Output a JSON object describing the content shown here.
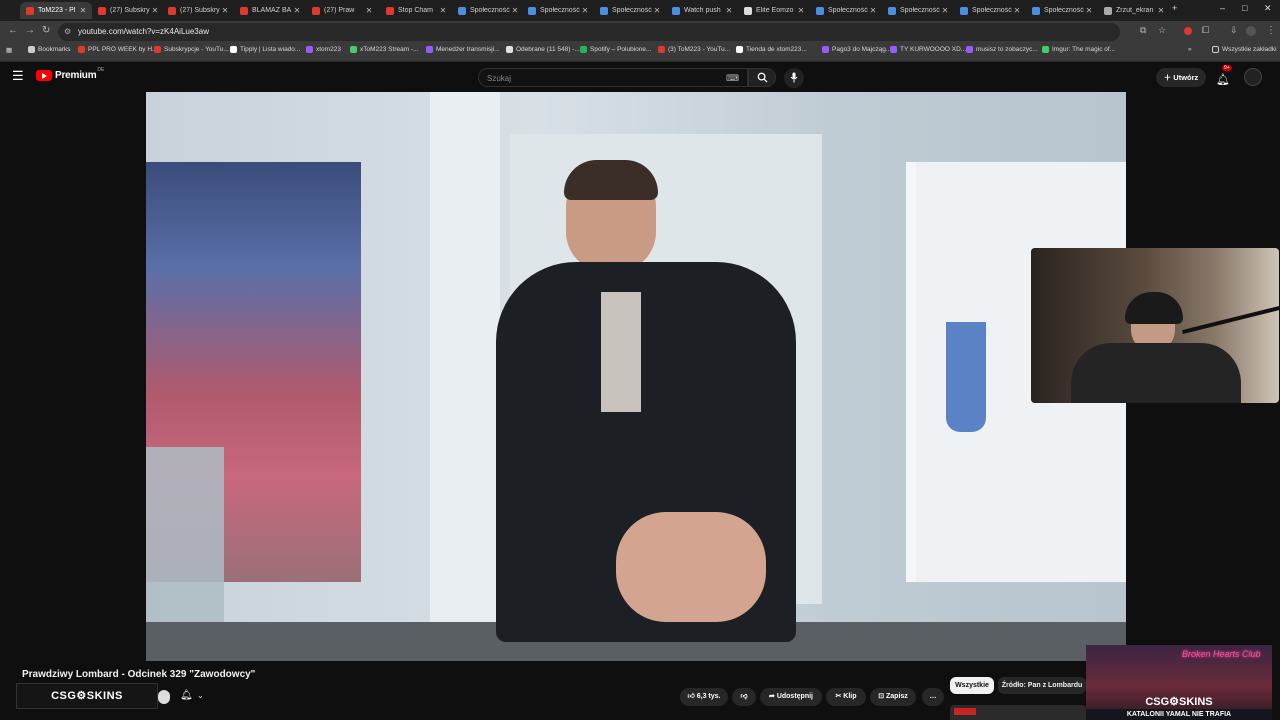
{
  "tabs": [
    {
      "label": "ToM223 - Pl",
      "fav": "#e0392b",
      "active": true
    },
    {
      "label": "(27) Subskryp",
      "fav": "#e0392b"
    },
    {
      "label": "(27) Subskryp",
      "fav": "#e0392b"
    },
    {
      "label": "BLAMAŻ BA",
      "fav": "#e0392b"
    },
    {
      "label": "(27) Praw",
      "fav": "#e0392b"
    },
    {
      "label": "Stop Cham",
      "fav": "#e0392b"
    },
    {
      "label": "Społeczność",
      "fav": "#4a8fe0"
    },
    {
      "label": "Społeczność",
      "fav": "#4a8fe0"
    },
    {
      "label": "Społeczność",
      "fav": "#4a8fe0"
    },
    {
      "label": "Watch push",
      "fav": "#4a8fe0"
    },
    {
      "label": "Elite Eomzo",
      "fav": "#dddddd"
    },
    {
      "label": "Społeczność",
      "fav": "#4a8fe0"
    },
    {
      "label": "Społeczność",
      "fav": "#4a8fe0"
    },
    {
      "label": "Społeczność",
      "fav": "#4a8fe0"
    },
    {
      "label": "Społeczność",
      "fav": "#4a8fe0"
    },
    {
      "label": "Zrzut_ekran",
      "fav": "#aaaaaa"
    }
  ],
  "address": {
    "url": "youtube.com/watch?v=zK4AiLue3aw"
  },
  "bookmarks": [
    {
      "label": "Bookmarks",
      "fav": "#cccccc"
    },
    {
      "label": "PPL PRO WEEK by H...",
      "fav": "#e0392b"
    },
    {
      "label": "Subskrypcje - YouTu...",
      "fav": "#e0392b"
    },
    {
      "label": "Tipply | Lista wiado...",
      "fav": "#ffffff"
    },
    {
      "label": "xtom223",
      "fav": "#9b59ff"
    },
    {
      "label": "xToM223 Stream -...",
      "fav": "#3fd06b"
    },
    {
      "label": "Menedżer transmisji...",
      "fav": "#9b59ff"
    },
    {
      "label": "Odebrane (11 548) -...",
      "fav": "#e0e0e0"
    },
    {
      "label": "Spotify – Polubione...",
      "fav": "#1db954"
    },
    {
      "label": "(3) ToM223 - YouTu...",
      "fav": "#e0392b"
    },
    {
      "label": "Tienda de xtom223...",
      "fav": "#ffffff"
    },
    {
      "label": "Pago3 do Majcząg...",
      "fav": "#9b59ff"
    },
    {
      "label": "TY KURWOOOO XD...",
      "fav": "#9b59ff"
    },
    {
      "label": "musisz to zobaczyc...",
      "fav": "#9b59ff"
    },
    {
      "label": "Imgur: The magic of...",
      "fav": "#3fd06b"
    }
  ],
  "bookmarks_all": "Wszystkie zakładki",
  "yt": {
    "logo": "Premium",
    "logo_sup": "DE",
    "search_placeholder": "Szukaj",
    "create_label": "Utwórz",
    "notif_count": "9+"
  },
  "video": {
    "title": "Prawdziwy Lombard - Odcinek 329 \"Zawodowcy\"",
    "likes": "6,3 tys.",
    "share": "Udostępnij",
    "clip": "Klip",
    "save": "Zapisz",
    "more": "…"
  },
  "chips": {
    "all": "Wszystkie",
    "source": "Źródło: Pan z Lombardu"
  },
  "overlay": {
    "csg_left": "CSG⚙SKINS",
    "csg_ad": "CSG⚙SKINS",
    "ad_sign": "Broken Hearts Club",
    "ad_ticker": "KATALONII YAMAL NIE TRAFIA"
  },
  "icons": {
    "menu": "hamburger-menu-icon",
    "search": "search-icon",
    "mic": "microphone-icon",
    "bell": "bell-icon",
    "like": "thumbs-up-icon",
    "dislike": "thumbs-down-icon",
    "share": "share-icon",
    "clip": "scissors-icon",
    "save": "bookmark-icon"
  },
  "colors": {
    "yt_red": "#ff0000",
    "bg": "#0f0f0f",
    "chip_active": "#f1f1f1"
  }
}
